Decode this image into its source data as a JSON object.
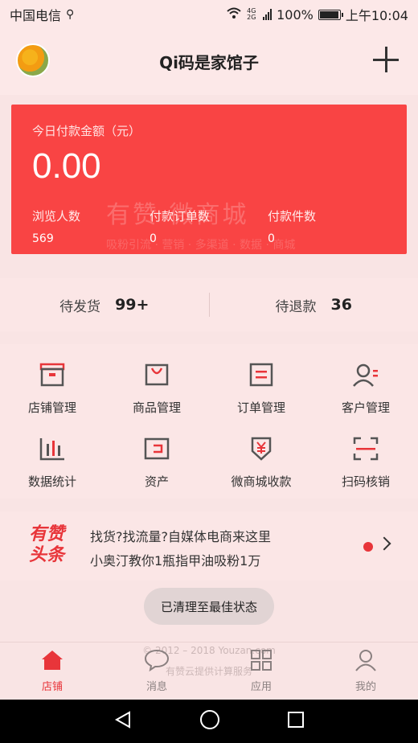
{
  "status_bar": {
    "carrier": "中国电信",
    "usb_icon": "usb-icon",
    "network": "4G 2G",
    "battery": "100%",
    "battery_level": 1.0,
    "time": "上午10:04"
  },
  "header": {
    "title": "Qi码是家馆子",
    "avatar": "avatar-flower",
    "add_icon": "plus-icon"
  },
  "summary_card": {
    "label": "今日付款金额（元）",
    "amount": "0.00",
    "stats": [
      {
        "label": "浏览人数",
        "value": "569"
      },
      {
        "label": "付款订单数",
        "value": "0"
      },
      {
        "label": "付款件数",
        "value": "0"
      }
    ],
    "watermark": "有赞·微商城",
    "watermark_sub": "吸粉引流 · 营销 · 多渠道 · 数据 · 商城",
    "color": "#f94444"
  },
  "pending": [
    {
      "label": "待发货",
      "count": "99+"
    },
    {
      "label": "待退款",
      "count": "36"
    }
  ],
  "features": [
    {
      "label": "店铺管理",
      "icon": "store-icon"
    },
    {
      "label": "商品管理",
      "icon": "bag-icon"
    },
    {
      "label": "订单管理",
      "icon": "order-icon"
    },
    {
      "label": "客户管理",
      "icon": "customer-icon"
    },
    {
      "label": "数据统计",
      "icon": "bar-chart-icon"
    },
    {
      "label": "资产",
      "icon": "wallet-icon"
    },
    {
      "label": "微商城收款",
      "icon": "yuan-receive-icon"
    },
    {
      "label": "扫码核销",
      "icon": "scan-icon"
    }
  ],
  "news": {
    "logo_line1": "有赞",
    "logo_line2": "头条",
    "lines": [
      "找货?找流量?自媒体电商来这里",
      "小奥汀教你1瓶指甲油吸粉1万"
    ]
  },
  "toast": "已清理至最佳状态",
  "footer": {
    "copyright": "© 2012 – 2018 Youzan.com",
    "provider": "有赞云提供计算服务"
  },
  "tabs": [
    {
      "label": "店铺",
      "icon": "home-icon",
      "active": true
    },
    {
      "label": "消息",
      "icon": "message-icon",
      "active": false
    },
    {
      "label": "应用",
      "icon": "apps-icon",
      "active": false
    },
    {
      "label": "我的",
      "icon": "profile-icon",
      "active": false
    }
  ],
  "accent_color": "#e8353a"
}
